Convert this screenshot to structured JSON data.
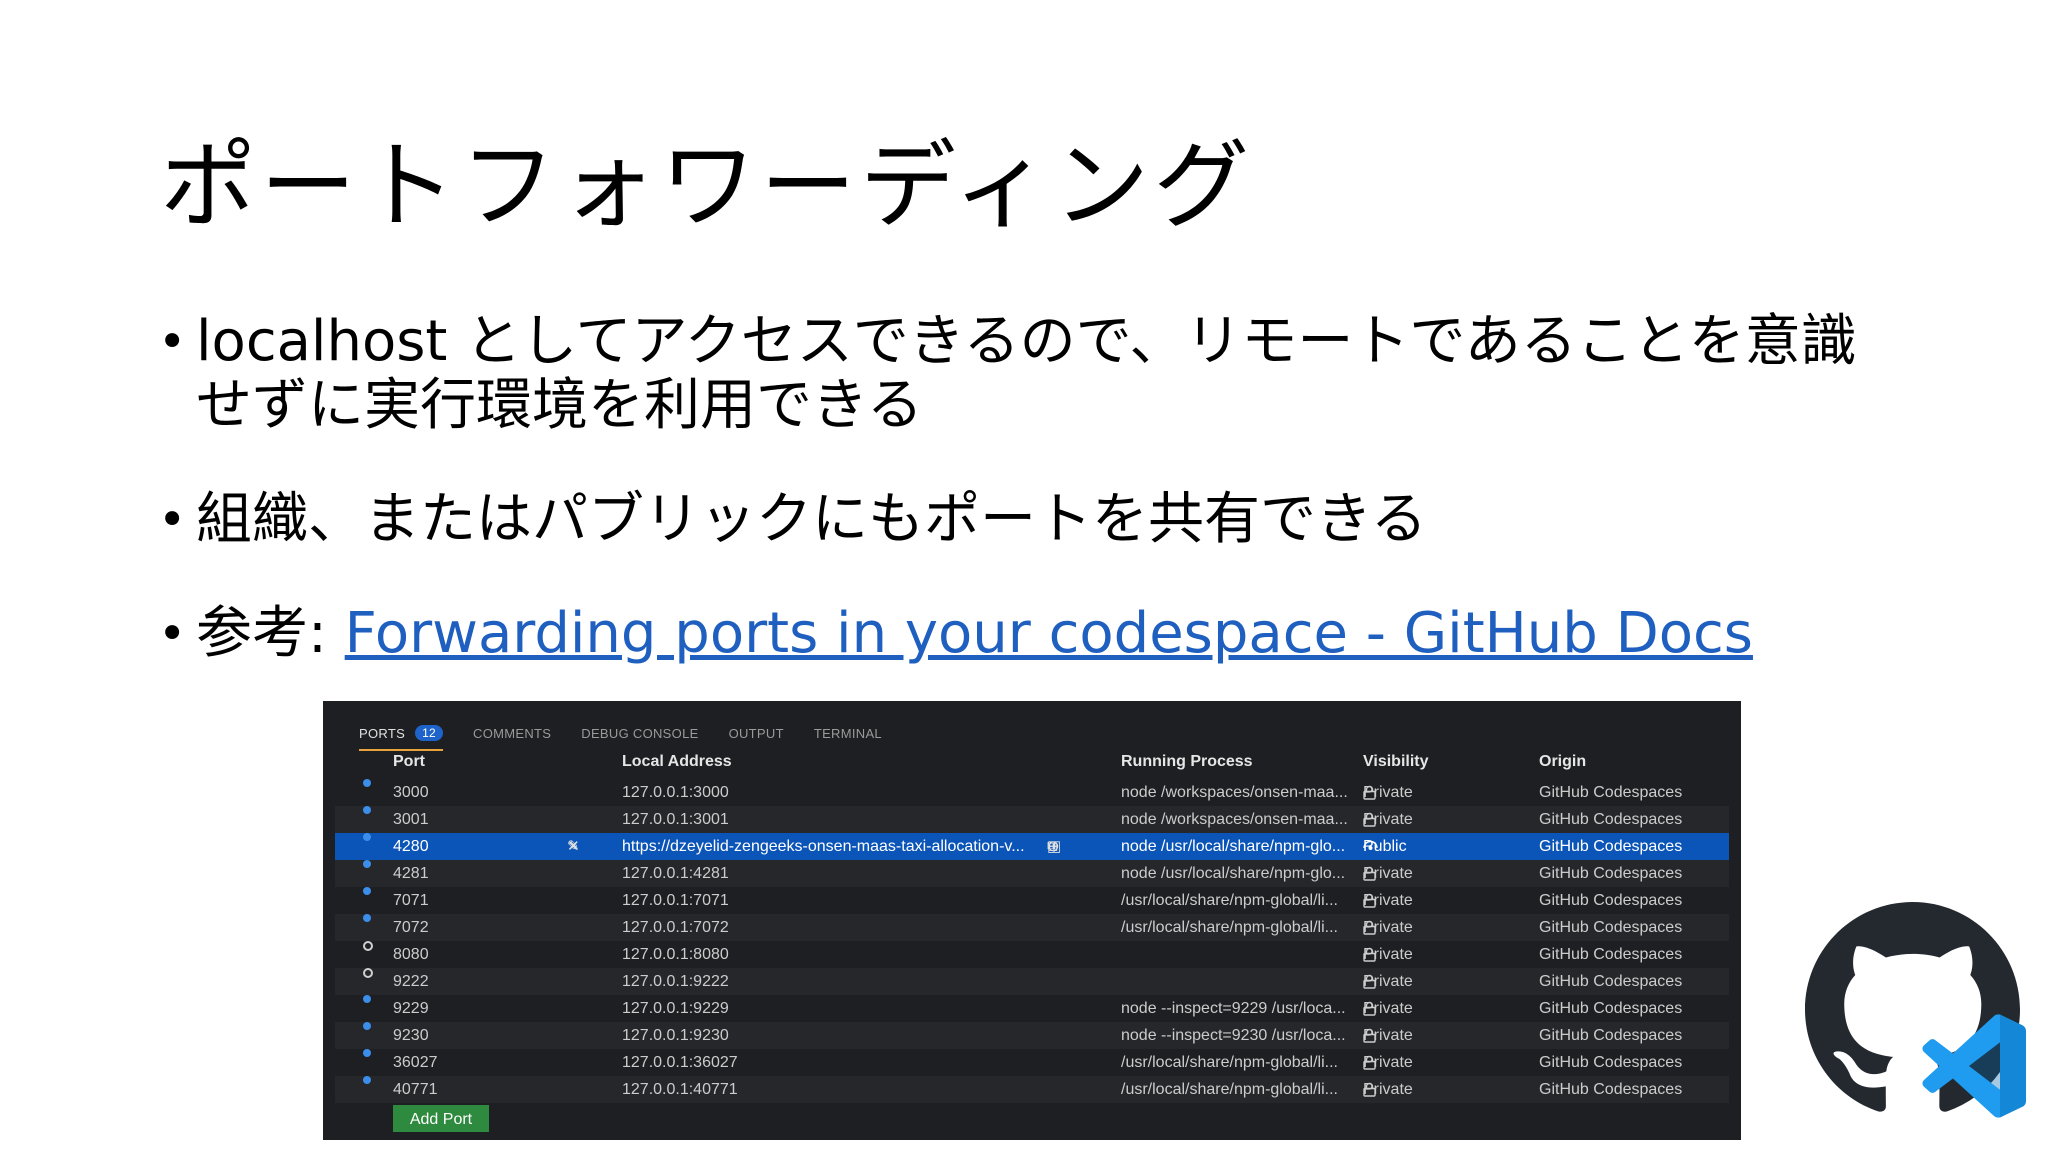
{
  "slide": {
    "title": "ポートフォワーディング",
    "bullets": [
      {
        "text": "localhost としてアクセスできるので、リモートであることを意識せずに実行環境を利用できる"
      },
      {
        "text": "組織、またはパブリックにもポートを共有できる"
      },
      {
        "prefix": "参考: ",
        "link": "Forwarding ports in your codespace - GitHub Docs"
      }
    ]
  },
  "panel": {
    "tabs": [
      {
        "label": "PORTS",
        "badge": "12",
        "active": true
      },
      {
        "label": "COMMENTS"
      },
      {
        "label": "DEBUG CONSOLE"
      },
      {
        "label": "OUTPUT"
      },
      {
        "label": "TERMINAL"
      }
    ],
    "columns": {
      "port": "Port",
      "address": "Local Address",
      "process": "Running Process",
      "visibility": "Visibility",
      "origin": "Origin"
    },
    "rows": [
      {
        "port": "3000",
        "address": "127.0.0.1:3000",
        "process": "node /workspaces/onsen-maa...",
        "visibility": "Private",
        "origin": "GitHub Codespaces",
        "active": true
      },
      {
        "port": "3001",
        "address": "127.0.0.1:3001",
        "process": "node /workspaces/onsen-maa...",
        "visibility": "Private",
        "origin": "GitHub Codespaces",
        "active": true
      },
      {
        "port": "4280",
        "address": "https://dzeyelid-zengeeks-onsen-maas-taxi-allocation-v...",
        "process": "node /usr/local/share/npm-glo...",
        "visibility": "Public",
        "origin": "GitHub Codespaces",
        "active": true,
        "selected": true
      },
      {
        "port": "4281",
        "address": "127.0.0.1:4281",
        "process": "node /usr/local/share/npm-glo...",
        "visibility": "Private",
        "origin": "GitHub Codespaces",
        "active": true
      },
      {
        "port": "7071",
        "address": "127.0.0.1:7071",
        "process": "/usr/local/share/npm-global/li...",
        "visibility": "Private",
        "origin": "GitHub Codespaces",
        "active": true
      },
      {
        "port": "7072",
        "address": "127.0.0.1:7072",
        "process": "/usr/local/share/npm-global/li...",
        "visibility": "Private",
        "origin": "GitHub Codespaces",
        "active": true
      },
      {
        "port": "8080",
        "address": "127.0.0.1:8080",
        "process": "",
        "visibility": "Private",
        "origin": "GitHub Codespaces",
        "active": false
      },
      {
        "port": "9222",
        "address": "127.0.0.1:9222",
        "process": "",
        "visibility": "Private",
        "origin": "GitHub Codespaces",
        "active": false
      },
      {
        "port": "9229",
        "address": "127.0.0.1:9229",
        "process": "node --inspect=9229 /usr/loca...",
        "visibility": "Private",
        "origin": "GitHub Codespaces",
        "active": true
      },
      {
        "port": "9230",
        "address": "127.0.0.1:9230",
        "process": "node --inspect=9230 /usr/loca...",
        "visibility": "Private",
        "origin": "GitHub Codespaces",
        "active": true
      },
      {
        "port": "36027",
        "address": "127.0.0.1:36027",
        "process": "/usr/local/share/npm-global/li...",
        "visibility": "Private",
        "origin": "GitHub Codespaces",
        "active": true
      },
      {
        "port": "40771",
        "address": "127.0.0.1:40771",
        "process": "/usr/local/share/npm-global/li...",
        "visibility": "Private",
        "origin": "GitHub Codespaces",
        "active": true
      }
    ],
    "add_port_label": "Add Port",
    "selected_row_icons": [
      "label-icon",
      "close-icon"
    ],
    "address_icons": [
      "copy-icon",
      "globe-icon",
      "preview-icon"
    ],
    "colors": {
      "accent": "#0b55b8",
      "active_dot": "#3b8eea",
      "add_button": "#2d8a3e",
      "link": "#1f5fbf"
    }
  },
  "logos": [
    "github-octocat-icon",
    "vscode-icon"
  ]
}
